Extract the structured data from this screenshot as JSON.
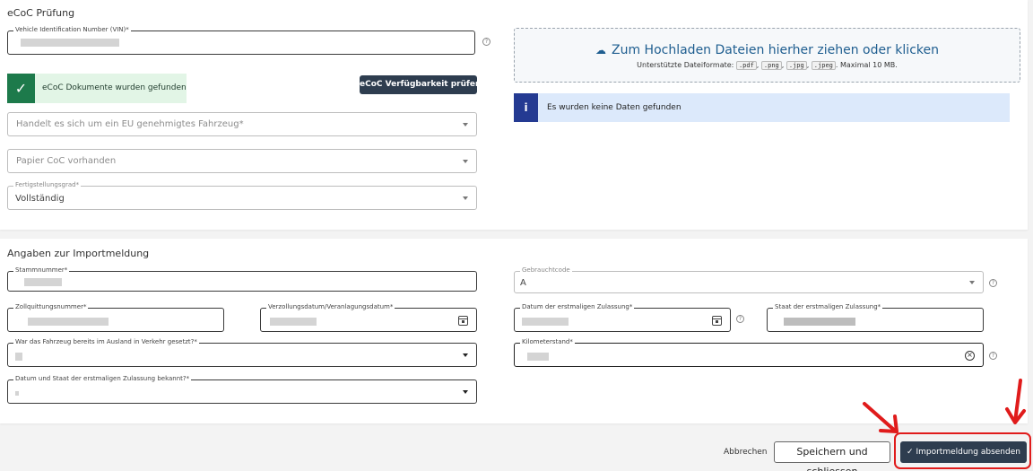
{
  "ecoc": {
    "title": "eCoC Prüfung",
    "vin_label": "Vehicle Identification Number (VIN)*",
    "success_text": "eCoC Dokumente wurden gefunden",
    "check_button": "eCoC Verfügbarkeit prüfen",
    "eu_placeholder": "Handelt es sich um ein EU genehmigtes Fahrzeug*",
    "papier_placeholder": "Papier CoC vorhanden",
    "fertig_label": "Fertigstellungsgrad*",
    "fertig_value": "Vollständig",
    "upload_title": "Zum Hochladen Dateien hierher ziehen oder klicken",
    "upload_sub_prefix": "Unterstützte Dateiformate:",
    "upload_formats": [
      ".pdf",
      ".png",
      ".jpg",
      ".jpeg"
    ],
    "upload_sub_suffix": ". Maximal 10 MB.",
    "info_icon": "i",
    "info_text": "Es wurden keine Daten gefunden"
  },
  "import": {
    "title": "Angaben zur Importmeldung",
    "stamm_label": "Stammnummer*",
    "zoll_label": "Zollquittungsnummer*",
    "verzoll_label": "Verzollungsdatum/Veranlagungsdatum*",
    "ausland_label": "War das Fahrzeug bereits im Ausland in Verkehr gesetzt?*",
    "datum_staat_label": "Datum und Staat der erstmaligen Zulassung bekannt?*",
    "gebrauch_label": "Gebrauchtcode",
    "gebrauch_value": "A",
    "datum_zul_label": "Datum der erstmaligen Zulassung*",
    "staat_zul_label": "Staat der erstmaligen Zulassung*",
    "km_label": "Kilometerstand*"
  },
  "footer": {
    "cancel": "Abbrechen",
    "save": "Speichern und schliessen",
    "submit": "Importmeldung absenden"
  },
  "icons": {
    "help": "?",
    "check": "✓",
    "clear": "×",
    "upload": "☁"
  },
  "colors": {
    "primary_button": "#2e3d4f",
    "success_green": "#1d7a4b",
    "info_blue": "#243a92",
    "highlight_red": "#e01b1b",
    "link_blue": "#1f5e90"
  }
}
